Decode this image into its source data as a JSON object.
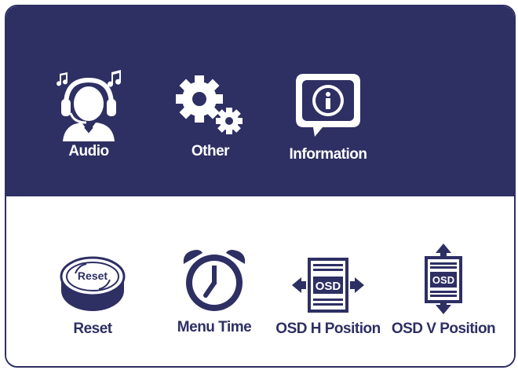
{
  "colors": {
    "navy": "#2e2f63",
    "white": "#ffffff"
  },
  "top_menu": [
    {
      "label": "Audio",
      "icon": "headphones-person-icon"
    },
    {
      "label": "Other",
      "icon": "gears-icon"
    },
    {
      "label": "Information",
      "icon": "info-bubble-icon"
    }
  ],
  "bottom_menu": [
    {
      "label": "Reset",
      "icon": "reset-button-icon",
      "icon_text": "Reset"
    },
    {
      "label": "Menu Time",
      "icon": "alarm-clock-icon"
    },
    {
      "label": "OSD H Position",
      "icon": "osd-horizontal-icon",
      "icon_text": "OSD"
    },
    {
      "label": "OSD V Position",
      "icon": "osd-vertical-icon",
      "icon_text": "OSD"
    }
  ]
}
